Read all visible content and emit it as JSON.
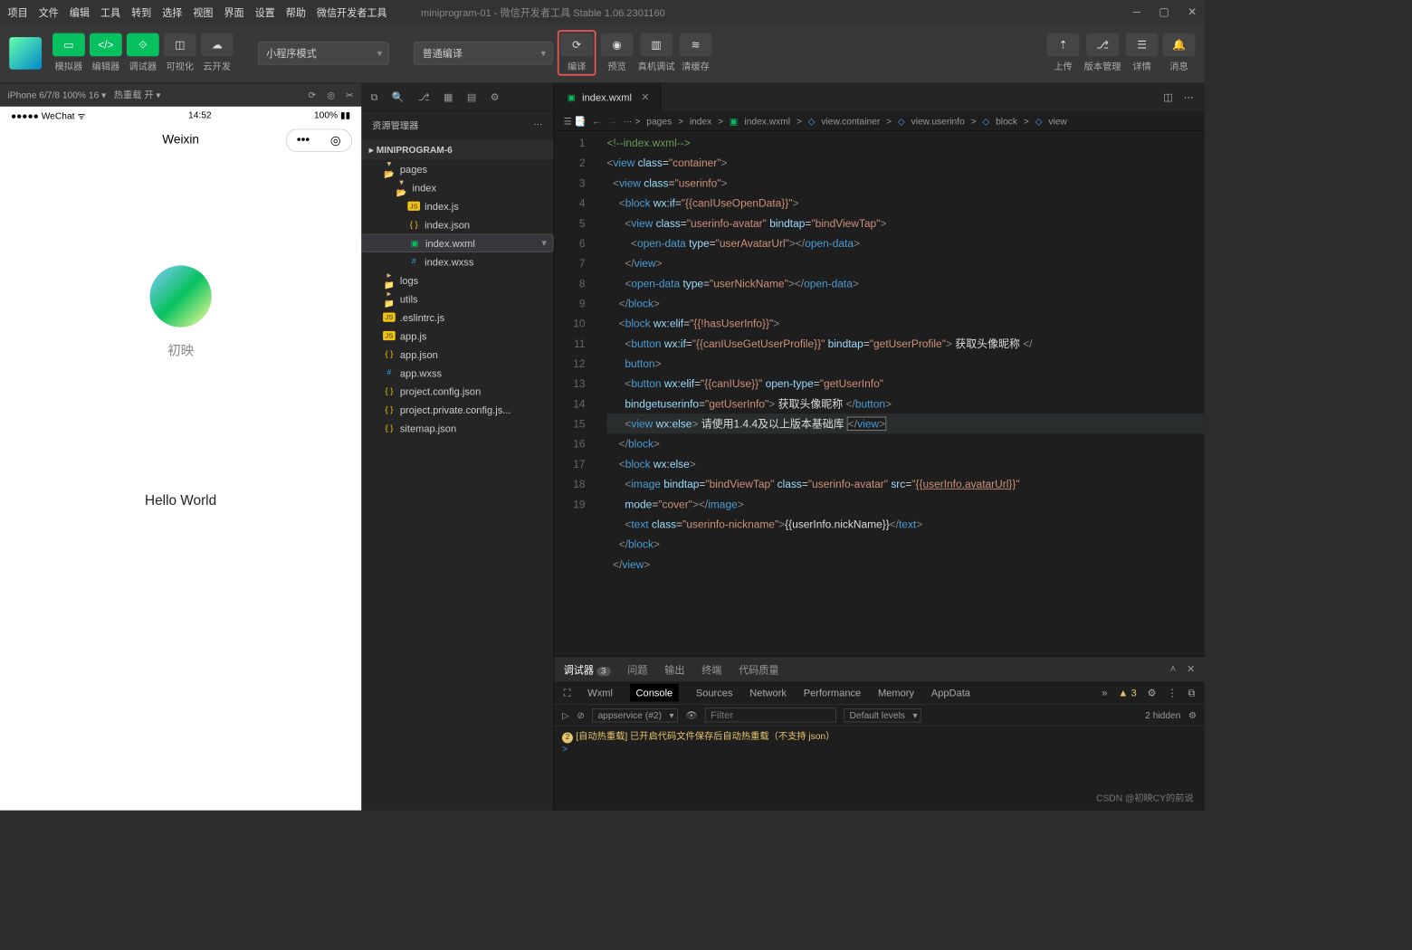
{
  "menu": [
    "项目",
    "文件",
    "编辑",
    "工具",
    "转到",
    "选择",
    "视图",
    "界面",
    "设置",
    "帮助",
    "微信开发者工具"
  ],
  "windowTitle": "miniprogram-01 - 微信开发者工具 Stable 1.06.2301160",
  "toolbar": {
    "simulator": "模拟器",
    "editor": "编辑器",
    "debugger": "调试器",
    "visual": "可视化",
    "cloud": "云开发",
    "mode": "小程序模式",
    "compileSel": "普通编译",
    "compile": "编译",
    "preview": "预览",
    "realdbg": "真机调试",
    "clear": "清缓存",
    "upload": "上传",
    "version": "版本管理",
    "details": "详情",
    "msg": "消息"
  },
  "simbar": {
    "device": "iPhone 6/7/8 100% 16",
    "hot": "热重载 开"
  },
  "phone": {
    "carrier": "WeChat",
    "time": "14:52",
    "batt": "100%",
    "title": "Weixin",
    "nick": "初映",
    "hello": "Hello World"
  },
  "explorer": {
    "title": "资源管理器",
    "project": "MINIPROGRAM-6",
    "tree": [
      {
        "d": 1,
        "ic": "folder",
        "n": "pages",
        "exp": 1
      },
      {
        "d": 2,
        "ic": "folder",
        "n": "index",
        "exp": 1
      },
      {
        "d": 3,
        "ic": "js",
        "n": "index.js"
      },
      {
        "d": 3,
        "ic": "json",
        "n": "index.json"
      },
      {
        "d": 3,
        "ic": "wxml",
        "n": "index.wxml",
        "sel": 1
      },
      {
        "d": 3,
        "ic": "wxss",
        "n": "index.wxss"
      },
      {
        "d": 1,
        "ic": "folder",
        "n": "logs"
      },
      {
        "d": 1,
        "ic": "folder",
        "n": "utils"
      },
      {
        "d": 1,
        "ic": "js",
        "n": ".eslintrc.js"
      },
      {
        "d": 1,
        "ic": "js",
        "n": "app.js"
      },
      {
        "d": 1,
        "ic": "json",
        "n": "app.json"
      },
      {
        "d": 1,
        "ic": "wxss",
        "n": "app.wxss"
      },
      {
        "d": 1,
        "ic": "json",
        "n": "project.config.json"
      },
      {
        "d": 1,
        "ic": "json",
        "n": "project.private.config.js..."
      },
      {
        "d": 1,
        "ic": "json",
        "n": "sitemap.json"
      }
    ]
  },
  "tab": {
    "file": "index.wxml"
  },
  "breadcrumb": [
    "pages",
    "index",
    "index.wxml",
    "view.container",
    "view.userinfo",
    "block",
    "view"
  ],
  "dbg": {
    "tabs": {
      "debugger": "调试器",
      "count": "3",
      "problems": "问题",
      "output": "输出",
      "terminal": "终端",
      "quality": "代码质量"
    },
    "devtabs": [
      "Wxml",
      "Console",
      "Sources",
      "Network",
      "Performance",
      "Memory",
      "AppData"
    ],
    "warnCount": "3",
    "scope": "appservice (#2)",
    "filterPH": "Filter",
    "levels": "Default levels",
    "hidden": "2 hidden",
    "log": "[自动热重载] 已开启代码文件保存后自动热重载（不支持 json）"
  },
  "watermark": "CSDN @初映CY的前说"
}
